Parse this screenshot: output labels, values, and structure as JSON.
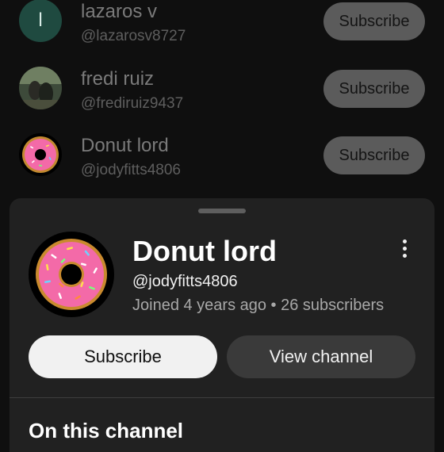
{
  "list": {
    "rows": [
      {
        "name": "lazaros v",
        "handle": "@lazarosv8727",
        "avatar_letter": "l",
        "subscribe_label": "Subscribe"
      },
      {
        "name": "fredi ruiz",
        "handle": "@frediruiz9437",
        "subscribe_label": "Subscribe"
      },
      {
        "name": "Donut lord",
        "handle": "@jodyfitts4806",
        "subscribe_label": "Subscribe"
      }
    ]
  },
  "sheet": {
    "title": "Donut lord",
    "handle": "@jodyfitts4806",
    "meta": "Joined 4 years ago • 26 subscribers",
    "subscribe_label": "Subscribe",
    "view_channel_label": "View channel",
    "section_title": "On this channel"
  },
  "colors": {
    "background": "#0f0f0f",
    "sheet": "#212121",
    "accent_pink": "#f36aa8"
  }
}
